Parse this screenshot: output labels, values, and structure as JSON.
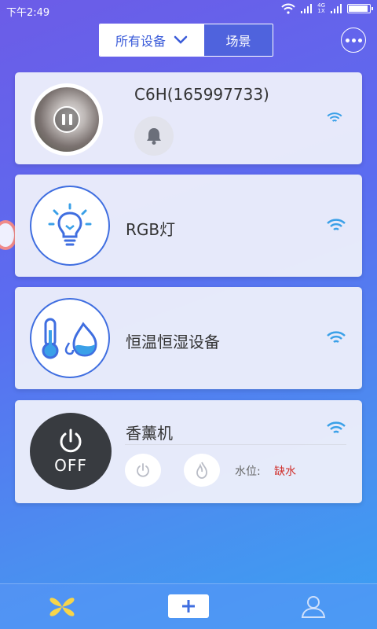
{
  "status_bar": {
    "time": "下午2:49",
    "network": "4G",
    "network_sub": "1X"
  },
  "header": {
    "tab_all": "所有设备",
    "tab_scene": "场景"
  },
  "devices": [
    {
      "name": "C6H(165997733)",
      "type": "camera"
    },
    {
      "name": "RGB灯",
      "type": "light"
    },
    {
      "name": "恒温恒湿设备",
      "type": "thermo-humidity"
    },
    {
      "name": "香薰机",
      "type": "aroma",
      "power_label": "OFF",
      "water_label": "水位:",
      "water_value": "缺水"
    }
  ],
  "colors": {
    "accent": "#3f6ee0",
    "wifi": "#3aa0e8",
    "warning": "#d0312d"
  }
}
